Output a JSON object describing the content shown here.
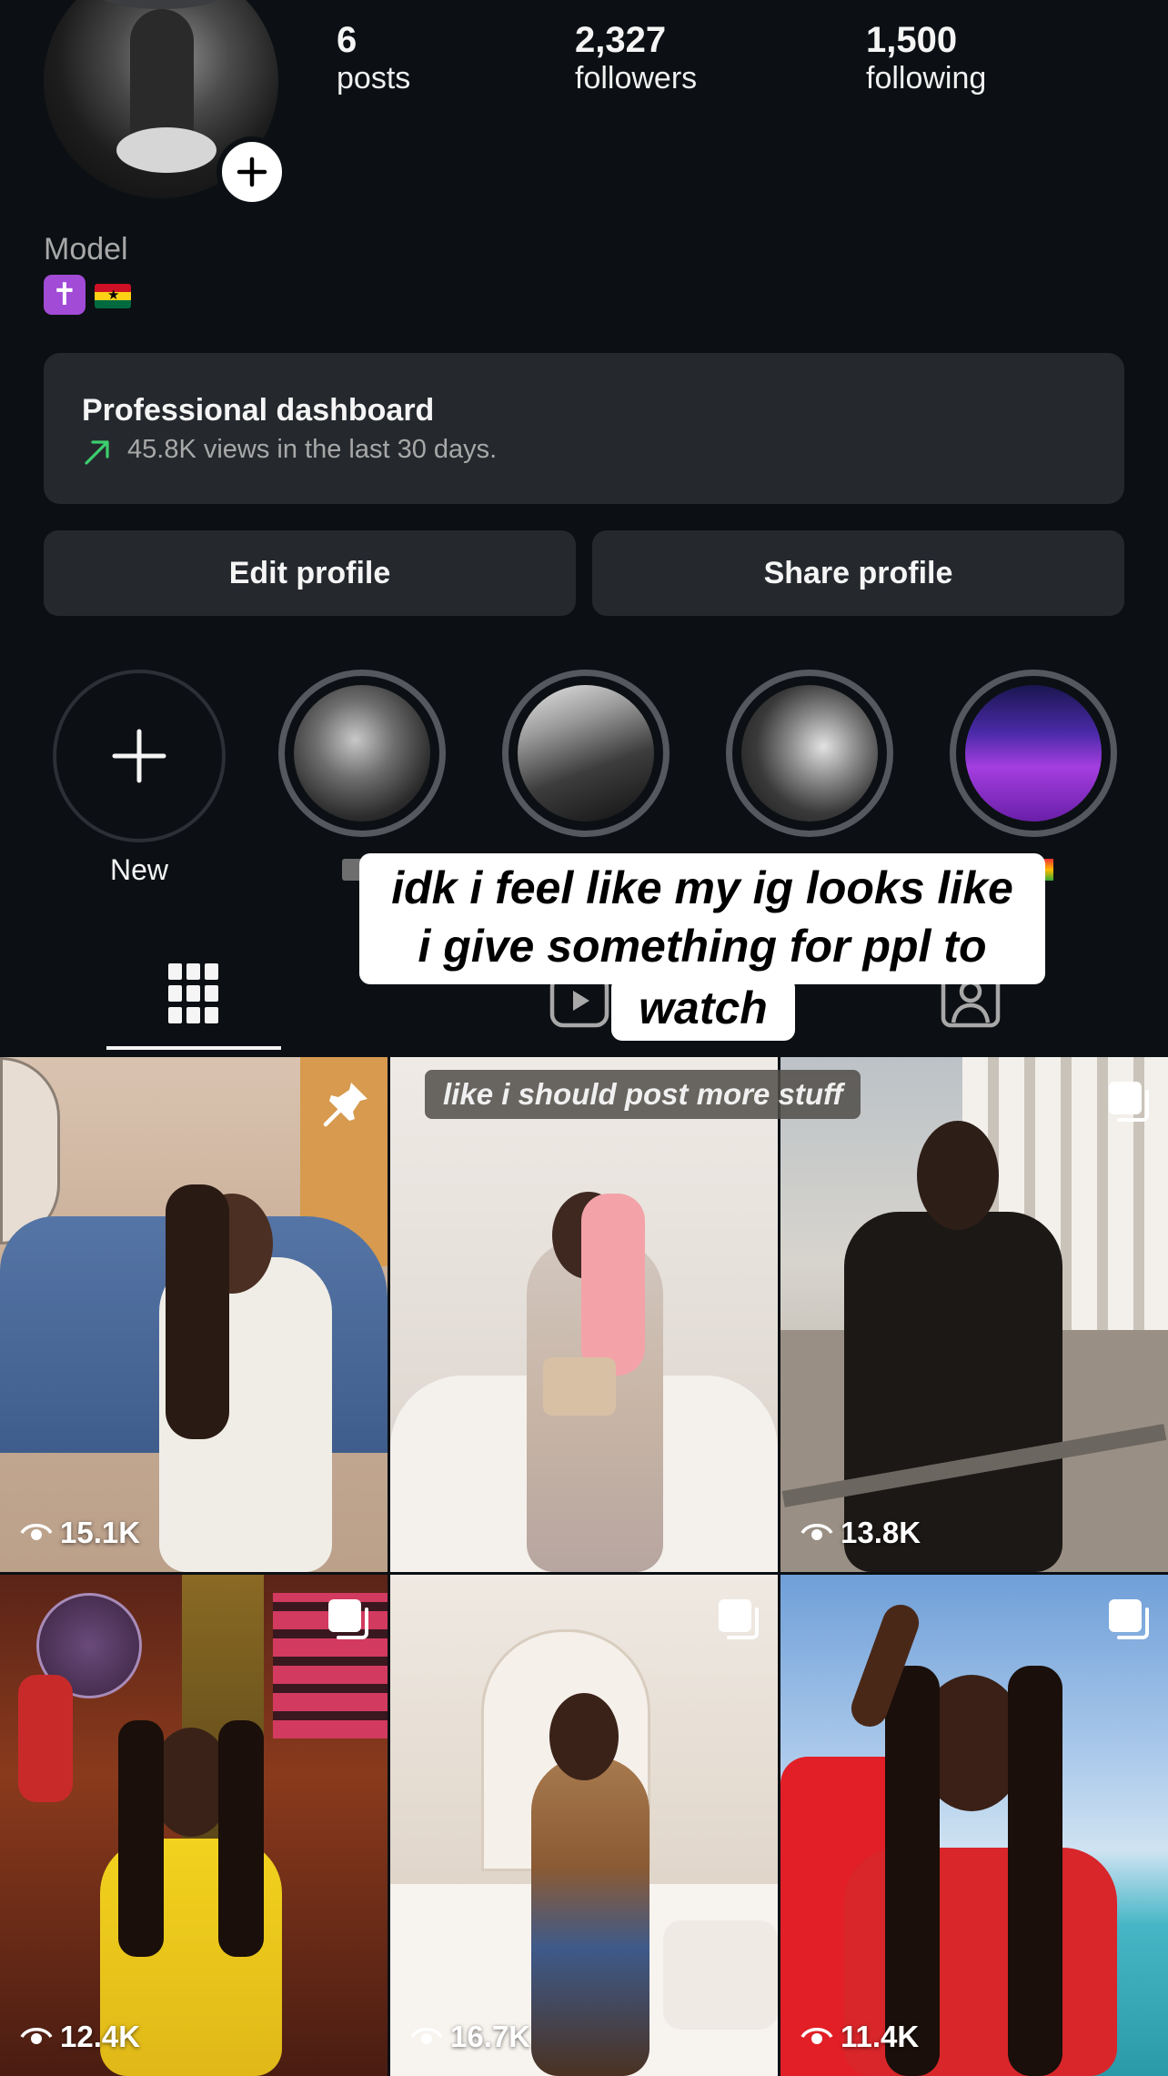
{
  "profile": {
    "stats": [
      {
        "value": "6",
        "label": "posts"
      },
      {
        "value": "2,327",
        "label": "followers"
      },
      {
        "value": "1,500",
        "label": "following"
      }
    ],
    "bio_category": "Model",
    "bio_emoji": "✝️🇬🇭"
  },
  "dashboard": {
    "title": "Professional dashboard",
    "subtitle": "45.8K views in the last 30 days.",
    "trend_color": "#3ccf6e"
  },
  "buttons": {
    "edit": "Edit profile",
    "share": "Share profile"
  },
  "highlights": [
    {
      "label": "New",
      "type": "add"
    },
    {
      "label": "",
      "type": "story"
    },
    {
      "label": "",
      "type": "story"
    },
    {
      "label": "",
      "type": "story"
    },
    {
      "label": "",
      "type": "story"
    }
  ],
  "overlay_caption": {
    "lines": [
      "idk i feel like my ig looks like",
      "i give something for ppl to",
      "watch"
    ],
    "inline": "like i should post more stuff"
  },
  "tabs": [
    {
      "name": "grid",
      "icon": "grid-icon",
      "active": true
    },
    {
      "name": "reels",
      "icon": "reels-icon",
      "active": false
    },
    {
      "name": "tagged",
      "icon": "tagged-icon",
      "active": false
    }
  ],
  "posts": [
    {
      "views": "15.1K",
      "badge": "pin-icon"
    },
    {
      "views": "",
      "badge": ""
    },
    {
      "views": "13.8K",
      "badge": "carousel-icon"
    },
    {
      "views": "12.4K",
      "badge": "carousel-icon"
    },
    {
      "views": "16.7K",
      "badge": "carousel-icon"
    },
    {
      "views": "11.4K",
      "badge": "carousel-icon"
    }
  ]
}
